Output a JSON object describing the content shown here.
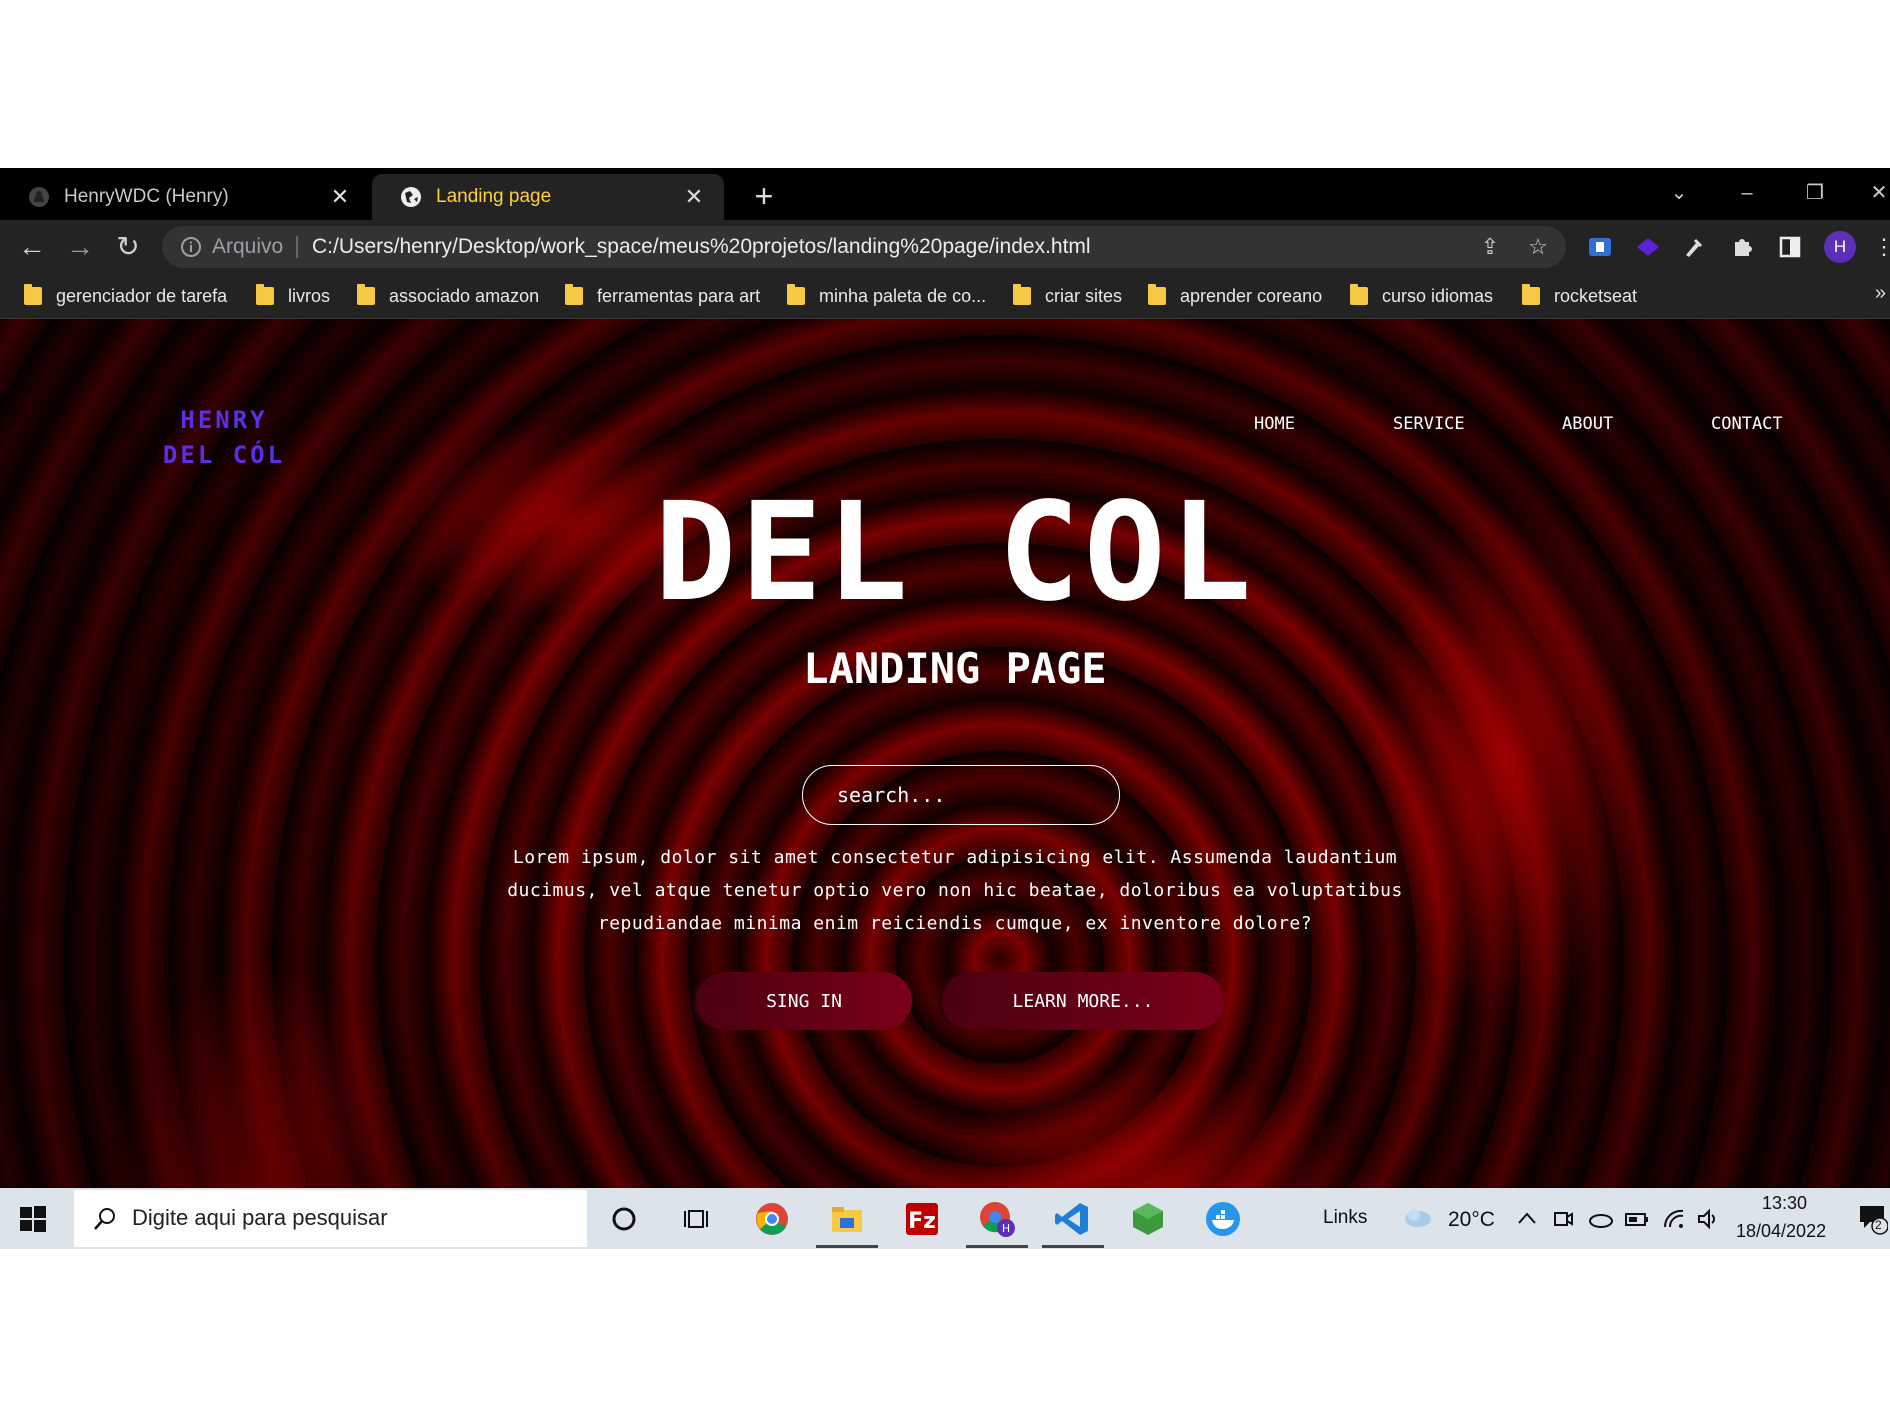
{
  "browser": {
    "tabs": [
      {
        "title": "HenryWDC (Henry)",
        "active": false,
        "icon": "github-icon"
      },
      {
        "title": "Landing page",
        "active": true,
        "icon": "globe-icon"
      }
    ],
    "address": {
      "label": "Arquivo",
      "url": "C:/Users/henry/Desktop/work_space/meus%20projetos/landing%20page/index.html"
    },
    "profile_initial": "H",
    "bookmarks": [
      "gerenciador de tarefa",
      "livros",
      "associado amazon",
      "ferramentas para art",
      "minha paleta de co...",
      "criar sites",
      "aprender coreano",
      "curso idiomas",
      "rocketseat"
    ],
    "bookmarks_more": "»"
  },
  "page": {
    "logo_line1": "HENRY",
    "logo_line2": "DEL CÓL",
    "logo_color": "#5b2eea",
    "nav": [
      "HOME",
      "SERVICE",
      "ABOUT",
      "CONTACT"
    ],
    "hero_title": "DEL COL",
    "hero_subtitle": "LANDING PAGE",
    "search_placeholder": "search...",
    "description": "Lorem ipsum, dolor sit amet consectetur adipisicing elit. Assumenda laudantium ducimus, vel atque tenetur optio vero non hic beatae, doloribus ea voluptatibus repudiandae minima enim reiciendis cumque, ex inventore dolore?",
    "buttons": {
      "sign_in": "SING IN",
      "learn_more": "LEARN MORE..."
    },
    "accent_color": "#d10000"
  },
  "taskbar": {
    "search_placeholder": "Digite aqui para pesquisar",
    "links_label": "Links",
    "weather": "20°C",
    "time": "13:30",
    "date": "18/04/2022",
    "notification_count": "2"
  }
}
